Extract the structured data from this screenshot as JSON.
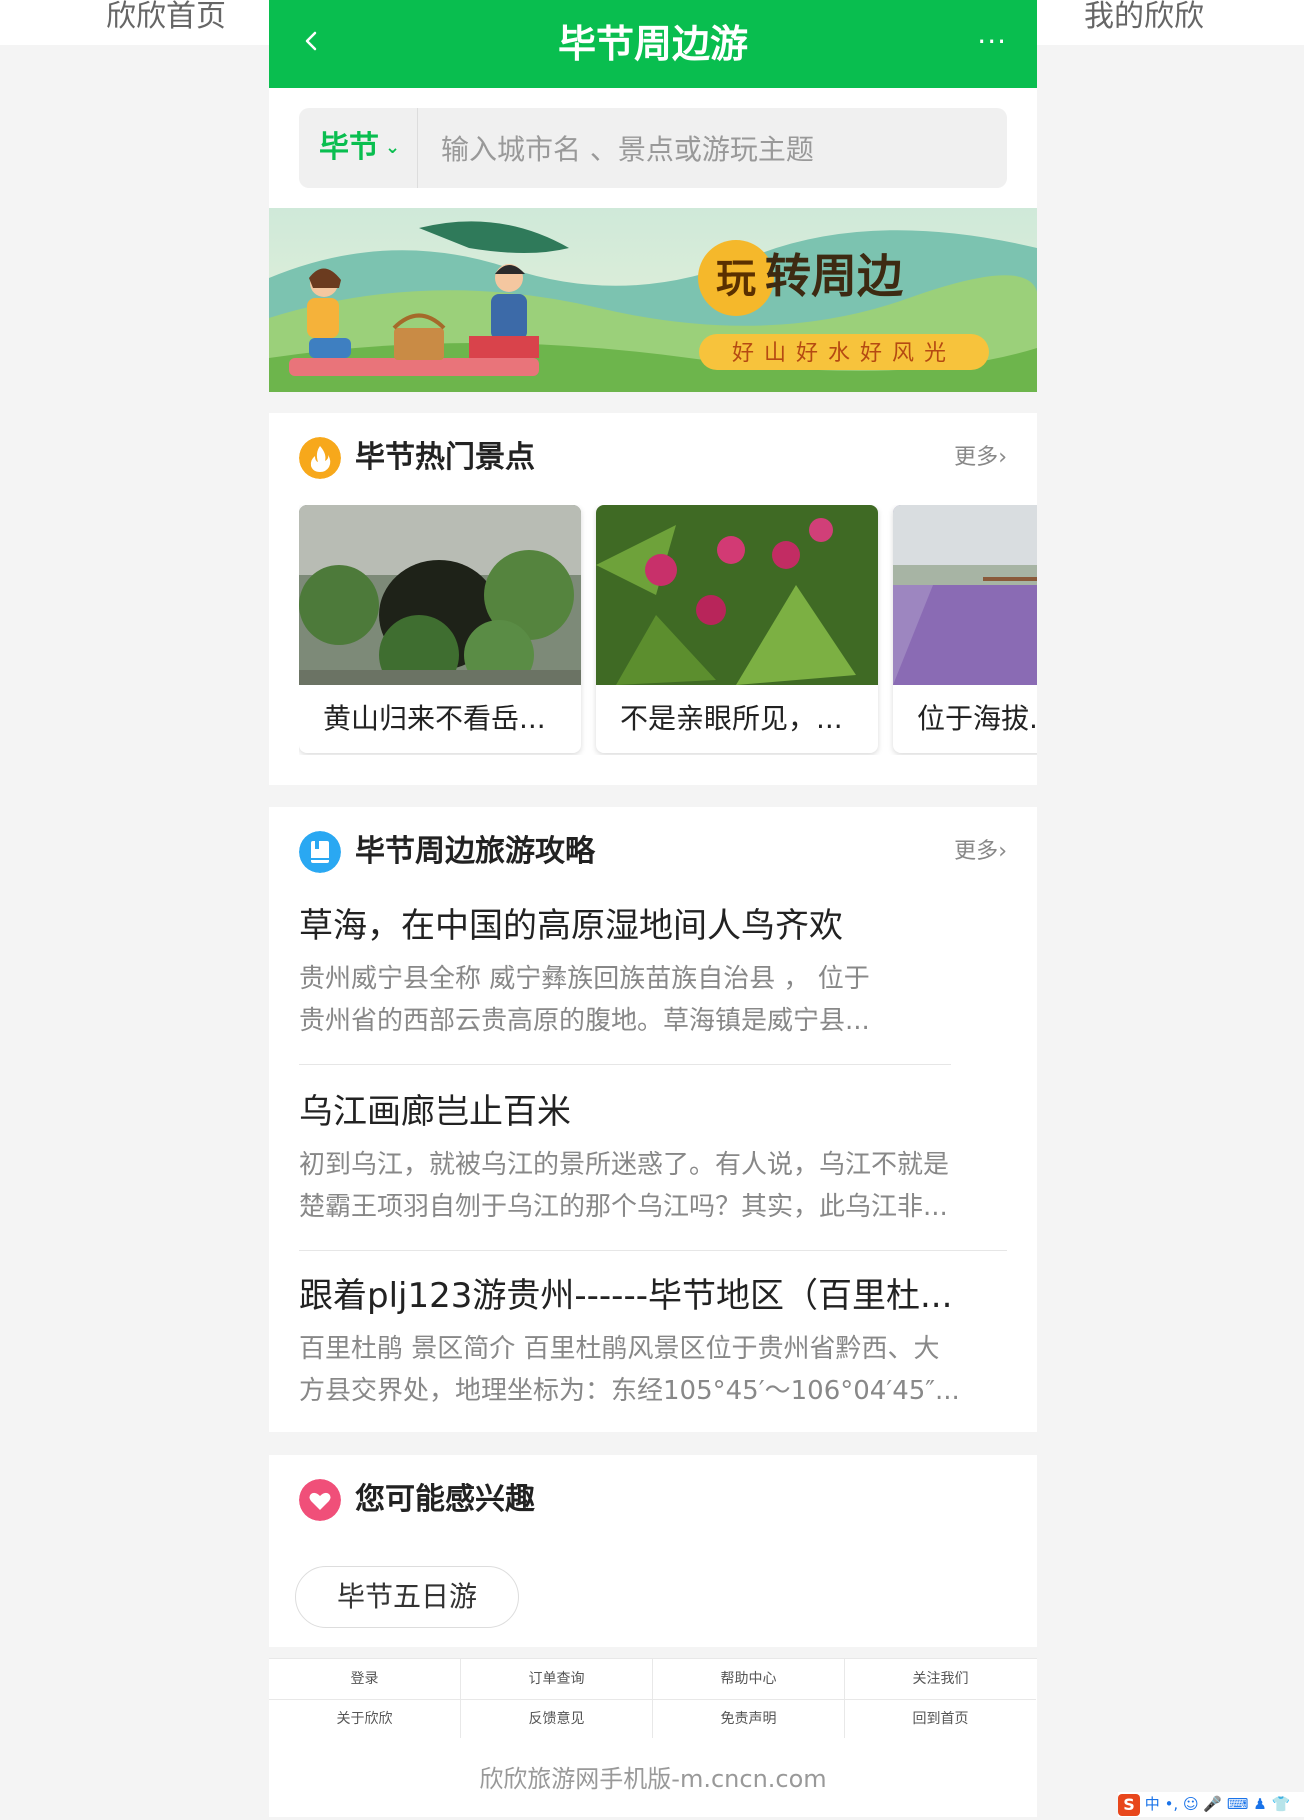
{
  "top_bar": {
    "left_link": "欣欣首页",
    "right_link": "我的欣欣"
  },
  "header": {
    "title": "毕节周边游",
    "back_icon": "chevron-left-icon",
    "more_label": "···"
  },
  "search": {
    "city": "毕节",
    "placeholder": "输入城市名 、景点或游玩主题"
  },
  "banner": {
    "title": "玩转周边",
    "subtitle": "好山好水好风光"
  },
  "hot_spots": {
    "title": "毕节热门景点",
    "more": "更多",
    "items": [
      {
        "caption": "黄山归来不看岳..."
      },
      {
        "caption": "不是亲眼所见，..."
      },
      {
        "caption": "位于海拔..."
      }
    ]
  },
  "guides": {
    "title": "毕节周边旅游攻略",
    "more": "更多",
    "items": [
      {
        "title": "草海，在中国的高原湿地间人鸟齐欢",
        "line1": "贵州威宁县全称 威宁彝族回族苗族自治县 ， 位于",
        "line2": "贵州省的西部云贵高原的腹地。草海镇是威宁县..."
      },
      {
        "title": "乌江画廊岂止百米",
        "line1": "初到乌江，就被乌江的景所迷惑了。有人说，乌江不就是",
        "line2": "楚霸王项羽自刎于乌江的那个乌江吗？其实，此乌江非..."
      },
      {
        "title": "跟着plj123游贵州------毕节地区（百里杜...",
        "line1": "百里杜鹃 景区简介 百里杜鹃风景区位于贵州省黔西、大",
        "line2": "方县交界处，地理坐标为：东经105°45′～106°04′45″..."
      }
    ]
  },
  "interest": {
    "title": "您可能感兴趣",
    "tag": "毕节五日游"
  },
  "footer": {
    "nav": [
      "登录",
      "订单查询",
      "帮助中心",
      "关注我们",
      "关于欣欣",
      "反馈意见",
      "免责声明",
      "回到首页"
    ],
    "copyright": "欣欣旅游网手机版-m.cncn.com"
  },
  "ime_bar": {
    "label": "中"
  },
  "colors": {
    "brand": "#09be4f",
    "hot_icon": "#f7a81b",
    "guide_icon": "#2aa8f2",
    "interest_icon": "#f04f79"
  }
}
